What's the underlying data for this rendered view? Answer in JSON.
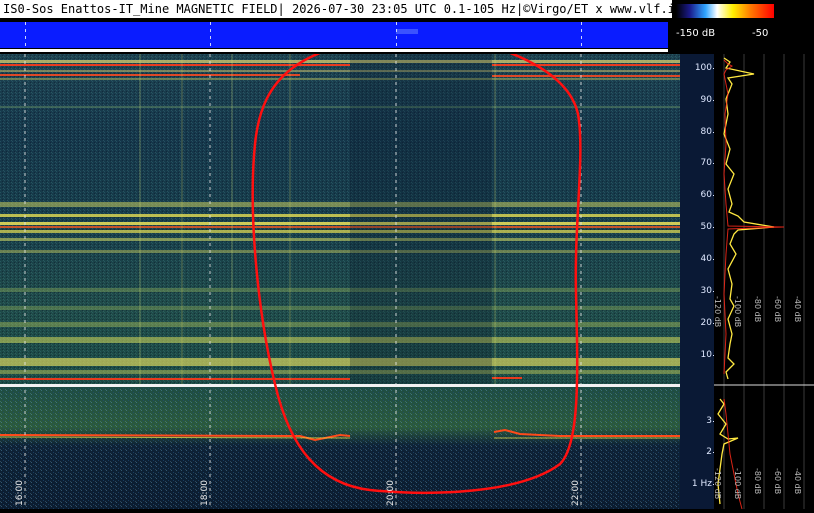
{
  "header": {
    "title": "IS0-Sos Enattos-IT_Mine MAGNETIC FIELD| 2026-07-30 23:05 UTC 0.1-105 Hz|©Virgo/ET x www.vlf.it"
  },
  "color_scale": {
    "min_label": "-150 dB",
    "max_label": "-50",
    "gradient": [
      "#000000",
      "#1a1a8a",
      "#2fa4ff",
      "#ffffff",
      "#ffef00",
      "#ff7a00",
      "#ff0000"
    ]
  },
  "frequency_axis": {
    "upper_ticks": [
      "100",
      "90",
      "80",
      "70",
      "60",
      "50",
      "40",
      "30",
      "20",
      "10"
    ],
    "lower_ticks": [
      "3",
      "2",
      "1 Hz"
    ]
  },
  "time_axis": {
    "labels": [
      "16:00",
      "18:00",
      "20:00",
      "22:00"
    ]
  },
  "side_panel": {
    "db_labels": [
      "-120 dB",
      "-100 dB",
      "-80 dB",
      "-60 dB",
      "-40 dB"
    ],
    "db_labels_lower": [
      "-120 dB",
      "-100 dB",
      "-80 dB",
      "-60 dB",
      "-40 dB"
    ]
  },
  "colors": {
    "background_spec": "#0d2a3a",
    "band_yellow": "#f2e84a",
    "line_red": "#ff2a1a",
    "annotation_red": "#ff1010",
    "blue_band": "#0a1cff"
  }
}
